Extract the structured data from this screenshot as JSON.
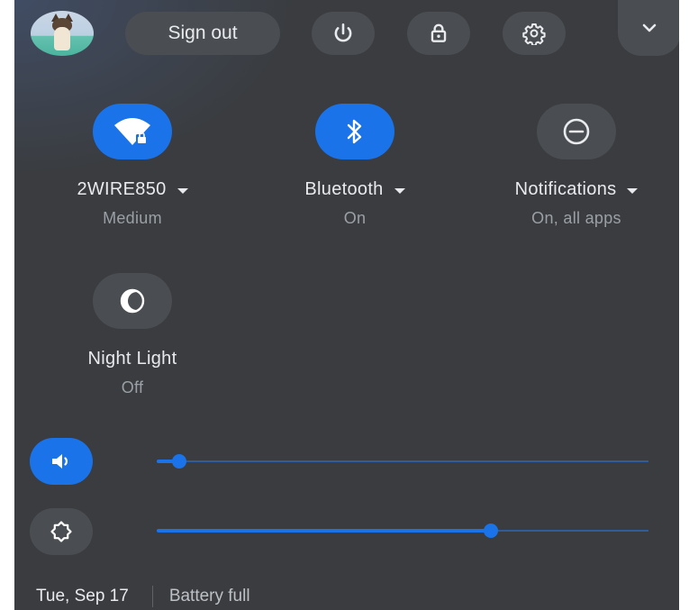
{
  "top_bar": {
    "sign_out_label": "Sign out",
    "icons": [
      "power-icon",
      "lock-icon",
      "gear-icon",
      "chevron-down-icon"
    ]
  },
  "pods": [
    {
      "icon": "wifi-locked-icon",
      "label": "2WIRE850",
      "sub": "Medium",
      "state": "on",
      "has_menu": true
    },
    {
      "icon": "bluetooth-icon",
      "label": "Bluetooth",
      "sub": "On",
      "state": "on",
      "has_menu": true
    },
    {
      "icon": "do-not-disturb-icon",
      "label": "Notifications",
      "sub": "On, all apps",
      "state": "off",
      "has_menu": true
    },
    {
      "icon": "night-light-icon",
      "label": "Night Light",
      "sub": "Off",
      "state": "off",
      "has_menu": false
    }
  ],
  "sliders": {
    "volume": {
      "icon": "volume-icon",
      "value": 0.045
    },
    "brightness": {
      "icon": "brightness-icon",
      "value": 0.68
    }
  },
  "footer": {
    "date": "Tue, Sep 17",
    "battery": "Battery full"
  },
  "colors": {
    "panel": "#3a3c3f",
    "accent": "#1a73e8",
    "button": "#4a4d51",
    "text": "#e8eaed",
    "subtext": "#9aa0a6"
  }
}
